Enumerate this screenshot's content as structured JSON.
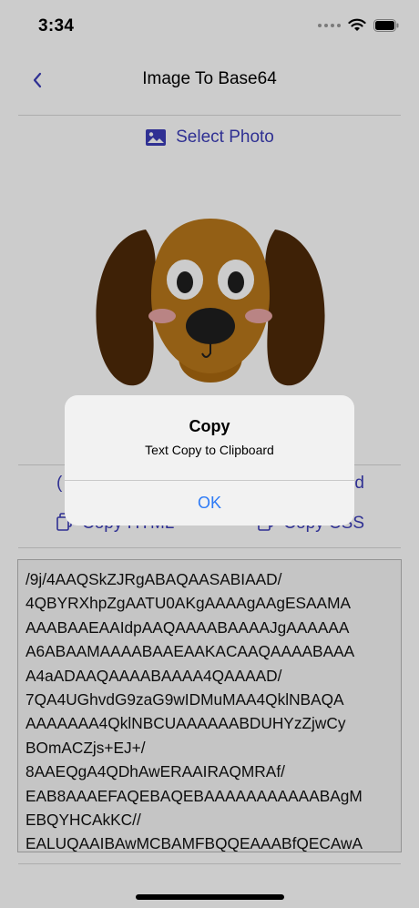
{
  "status_bar": {
    "time": "3:34"
  },
  "nav": {
    "back_icon": "chevron-left-icon",
    "title": "Image To Base64"
  },
  "select_photo": {
    "icon": "photo-icon",
    "label": "Select Photo"
  },
  "actions": {
    "row1_left_partial": "(",
    "row1_right_partial": "d",
    "copy_html": "Copy HTML",
    "copy_css": "Copy CSS"
  },
  "base64": {
    "lines": [
      "/9j/4AAQSkZJRgABAQAASABIAAD/",
      "4QBYRXhpZgAATU0AKgAAAAgAAgESAAMA",
      "AAABAAEAAIdpAAQAAAABAAAAJgAAAAAA",
      "A6ABAAMAAAABAAEAAKACAAQAAAABAAA",
      "A4aADAAQAAAABAAAA4QAAAAD/",
      "7QA4UGhvdG9zaG9wIDMuMAA4QklNBAQA",
      "AAAAAAA4QklNBCUAAAAAABDUHYzZjwCy",
      "BOmACZjs+EJ+/",
      "8AAEQgA4QDhAwERAAIRAQMRAf/",
      "EAB8AAAEFAQEBAQEBAAAAAAAAAAABAgM",
      "EBQYHCAkKC//",
      "EALUQAAIBAwMCBAMFBQQEAAABfQECAwA"
    ]
  },
  "alert": {
    "title": "Copy",
    "message": "Text Copy to Clipboard",
    "ok_label": "OK"
  },
  "colors": {
    "accent": "#3b3db8",
    "alert_button": "#2e7bf6"
  }
}
